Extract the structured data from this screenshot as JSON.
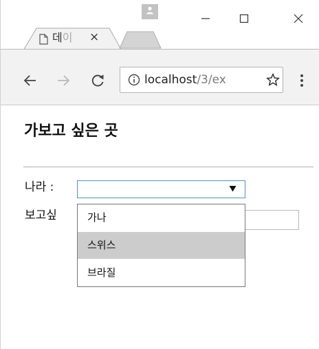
{
  "browser": {
    "tab": {
      "title": "데",
      "title_faded": "이",
      "close_glyph": "×"
    },
    "window_controls": {
      "minimize_glyph": "—",
      "close_glyph": "✕"
    },
    "address": {
      "host": "localhost",
      "path": "/3/ex"
    }
  },
  "page": {
    "title": "가보고 싶은 곳",
    "country_label": "나라 :",
    "want_label": "보고싶",
    "select": {
      "options": [
        "가나",
        "스위스",
        "브라질"
      ],
      "highlighted_index": 1
    }
  },
  "colors": {
    "select_border": "#4a90d9",
    "highlight": "#cccccc",
    "toolbar": "#f2f2f2"
  }
}
